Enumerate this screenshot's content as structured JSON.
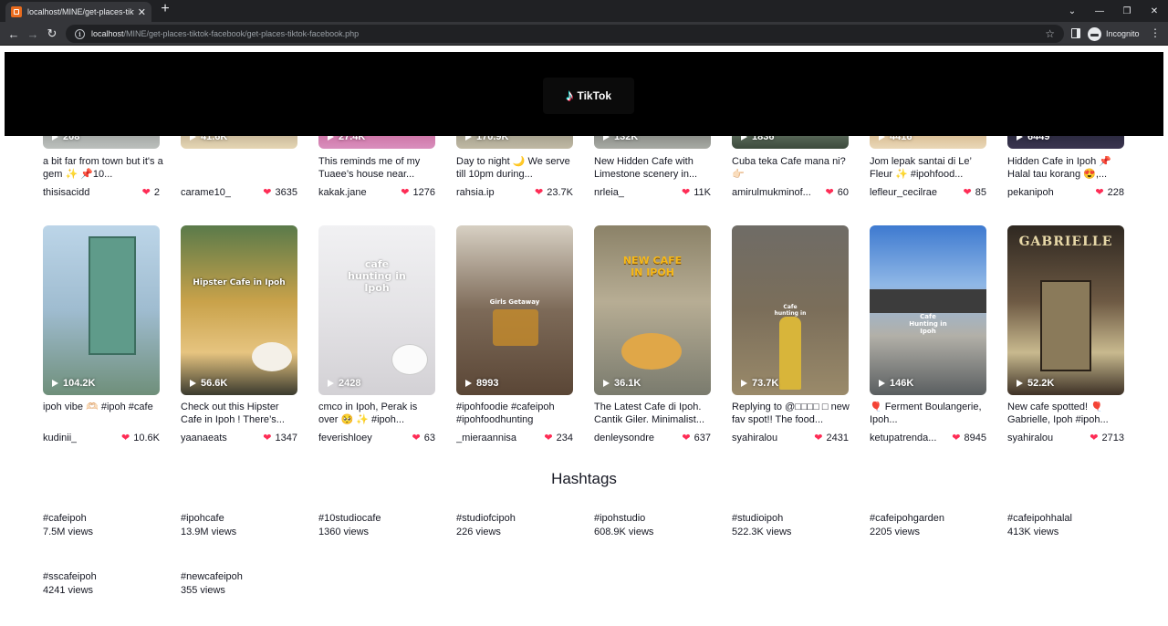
{
  "browser": {
    "tab_title": "localhost/MINE/get-places-tikto",
    "tab_close": "✕",
    "new_tab": "+",
    "url_host": "localhost",
    "url_path": "/MINE/get-places-tiktok-facebook/get-places-tiktok-facebook.php",
    "incognito_label": "Incognito",
    "window_controls": [
      "⌄",
      "—",
      "❐",
      "✕"
    ]
  },
  "header": {
    "logo_text": "TikTok",
    "logo_glyph": "♪",
    "background": "#000000"
  },
  "colors": {
    "heart": "#fe2c55",
    "text": "#161823"
  },
  "videos_row1": [
    {
      "plays": "208",
      "caption": "a bit far from town but it's a gem ✨ 📌10...",
      "author": "thisisacidd",
      "likes": "2"
    },
    {
      "plays": "41.6K",
      "caption": "",
      "author": "carame10_",
      "likes": "3635"
    },
    {
      "plays": "27.4K",
      "caption": "This reminds me of my Tuaee’s house near...",
      "author": "kakak.jane",
      "likes": "1276"
    },
    {
      "plays": "170.9K",
      "caption": "Day to night 🌙 We serve till 10pm during...",
      "author": "rahsia.ip",
      "likes": "23.7K"
    },
    {
      "plays": "132K",
      "caption": "New Hidden Cafe with Limestone scenery in...",
      "author": "nrleia_",
      "likes": "11K"
    },
    {
      "plays": "1836",
      "caption": "Cuba teka Cafe mana ni? 👉🏻",
      "author": "amirulmukminof...",
      "likes": "60"
    },
    {
      "plays": "4416",
      "caption": "Jom lepak santai di Le’ Fleur ✨ #ipohfood...",
      "author": "lefleur_cecilrae",
      "likes": "85"
    },
    {
      "plays": "6449",
      "caption": "Hidden Cafe in Ipoh 📌 Halal tau korang 😍,...",
      "author": "pekanipoh",
      "likes": "228"
    }
  ],
  "videos_row2": [
    {
      "plays": "104.2K",
      "caption": "ipoh vibe 🫶🏻 #ipoh #cafe",
      "author": "kudinii_",
      "likes": "10.6K",
      "overlay": ""
    },
    {
      "plays": "56.6K",
      "caption": "Check out this Hipster Cafe in Ipoh ! There’s...",
      "author": "yaanaeats",
      "likes": "1347",
      "overlay": "Hipster Cafe in Ipoh"
    },
    {
      "plays": "2428",
      "caption": "cmco in Ipoh, Perak is over 🥺 ✨ #ipoh...",
      "author": "feverishloey",
      "likes": "63",
      "overlay": "cafe hunting in Ipoh"
    },
    {
      "plays": "8993",
      "caption": "#ipohfoodie #cafeipoh #ipohfoodhunting",
      "author": "_mieraannisa",
      "likes": "234",
      "overlay": "Girls Getaway"
    },
    {
      "plays": "36.1K",
      "caption": "The Latest Cafe di Ipoh. Cantik Giler. Minimalist...",
      "author": "denleysondre",
      "likes": "637",
      "overlay": "NEW CAFE IN IPOH"
    },
    {
      "plays": "73.7K",
      "caption": "Replying to @□□□□ □ new fav spot!! The food...",
      "author": "syahiralou",
      "likes": "2431",
      "overlay": "Cafe hunting in Ipoh"
    },
    {
      "plays": "146K",
      "caption": "🎈 Ferment Boulangerie, Ipoh...",
      "author": "ketupatrenda...",
      "likes": "8945",
      "overlay": "Cafe Hunting in Ipoh"
    },
    {
      "plays": "52.2K",
      "caption": "New cafe spotted! 🎈 Gabrielle, Ipoh #ipoh...",
      "author": "syahiralou",
      "likes": "2713",
      "overlay": "GABRIELLE"
    }
  ],
  "hashtags_title": "Hashtags",
  "hashtags": [
    {
      "name": "#cafeipoh",
      "views": "7.5M views"
    },
    {
      "name": "#ipohcafe",
      "views": "13.9M views"
    },
    {
      "name": "#10studiocafe",
      "views": "1360 views"
    },
    {
      "name": "#studiofcipoh",
      "views": "226 views"
    },
    {
      "name": "#ipohstudio",
      "views": "608.9K views"
    },
    {
      "name": "#studioipoh",
      "views": "522.3K views"
    },
    {
      "name": "#cafeipohgarden",
      "views": "2205 views"
    },
    {
      "name": "#cafeipohhalal",
      "views": "413K views"
    },
    {
      "name": "#sscafeipoh",
      "views": "4241 views"
    },
    {
      "name": "#newcafeipoh",
      "views": "355 views"
    }
  ]
}
